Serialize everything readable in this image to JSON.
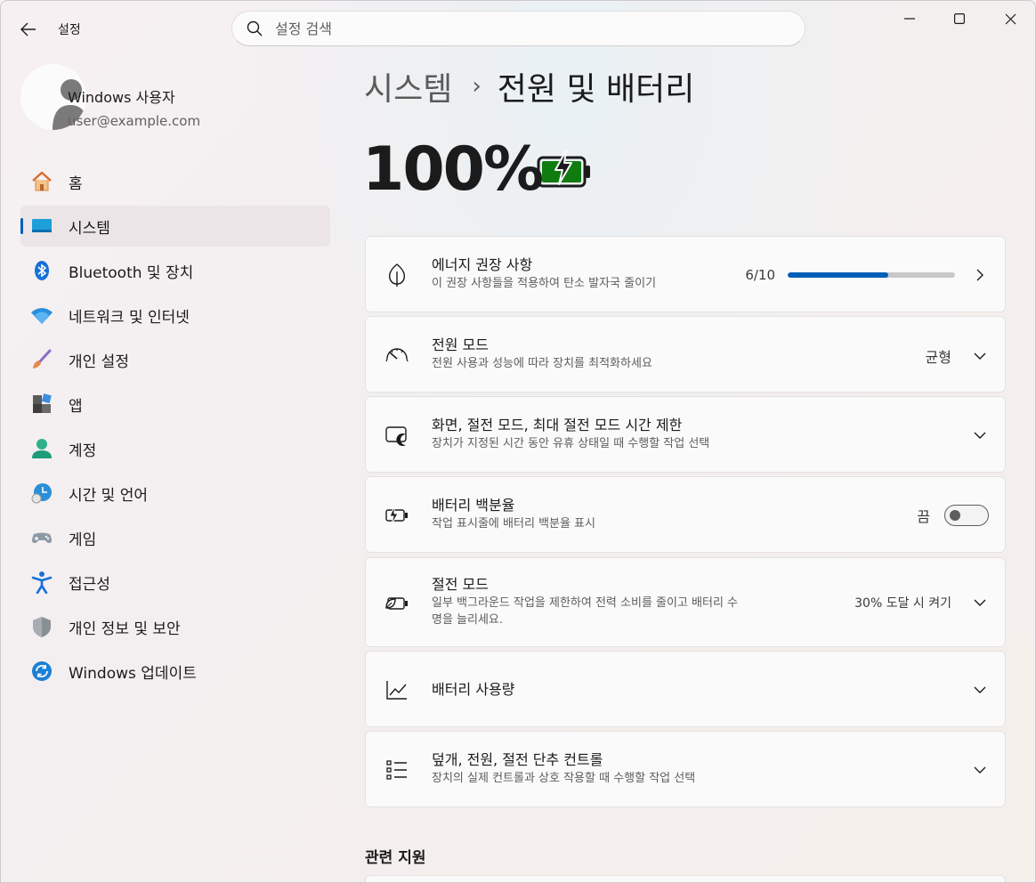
{
  "app": {
    "title": "설정"
  },
  "search": {
    "placeholder": "설정 검색"
  },
  "user": {
    "name": "Windows 사용자",
    "email": "user@example.com"
  },
  "nav": [
    {
      "id": "home",
      "label": "홈",
      "icon": "home-icon"
    },
    {
      "id": "system",
      "label": "시스템",
      "icon": "monitor-icon",
      "active": true
    },
    {
      "id": "bluetooth",
      "label": "Bluetooth 및 장치",
      "icon": "bluetooth-icon"
    },
    {
      "id": "network",
      "label": "네트워크 및 인터넷",
      "icon": "wifi-icon"
    },
    {
      "id": "personalization",
      "label": "개인 설정",
      "icon": "brush-icon"
    },
    {
      "id": "apps",
      "label": "앱",
      "icon": "apps-icon"
    },
    {
      "id": "accounts",
      "label": "계정",
      "icon": "person-icon"
    },
    {
      "id": "time",
      "label": "시간 및 언어",
      "icon": "clock-globe-icon"
    },
    {
      "id": "gaming",
      "label": "게임",
      "icon": "gamepad-icon"
    },
    {
      "id": "accessibility",
      "label": "접근성",
      "icon": "accessibility-icon"
    },
    {
      "id": "privacy",
      "label": "개인 정보 및 보안",
      "icon": "shield-icon"
    },
    {
      "id": "update",
      "label": "Windows 업데이트",
      "icon": "update-icon"
    }
  ],
  "breadcrumb": {
    "parent": "시스템",
    "separator": "›",
    "current": "전원 및 배터리"
  },
  "battery": {
    "percent": "100%",
    "percent_value": 100,
    "charging": true
  },
  "cards": {
    "energy": {
      "title": "에너지 권장 사항",
      "subtitle": "이 권장 사항들을 적용하여 탄소 발자국 줄이기",
      "progress_label": "6/10",
      "progress_value": 0.6
    },
    "power_mode": {
      "title": "전원 모드",
      "subtitle": "전원 사용과 성능에 따라 장치를 최적화하세요",
      "value": "균형"
    },
    "screen_sleep": {
      "title": "화면, 절전 모드, 최대 절전 모드 시간 제한",
      "subtitle": "장치가 지정된 시간 동안 유휴 상태일 때 수행할 작업 선택"
    },
    "battery_percent": {
      "title": "배터리 백분율",
      "subtitle": "작업 표시줄에 배터리 백분율 표시",
      "toggle_label": "끔",
      "toggle_on": false
    },
    "battery_saver": {
      "title": "절전 모드",
      "subtitle_line1": "일부 백그라운드 작업을 제한하여 전력 소비를 줄이고 배터리 수",
      "subtitle_line2": "명을 늘리세요.",
      "value": "30% 도달 시 켜기"
    },
    "battery_usage": {
      "title": "배터리 사용량"
    },
    "lid_power": {
      "title": "덮개, 전원, 절전 단추 컨트롤",
      "subtitle": "장치의 실제 컨트롤과 상호 작용할 때 수행할 작업 선택"
    }
  },
  "related": {
    "header": "관련 지원"
  },
  "colors": {
    "accent": "#005fb8",
    "battery_green": "#107c10"
  }
}
